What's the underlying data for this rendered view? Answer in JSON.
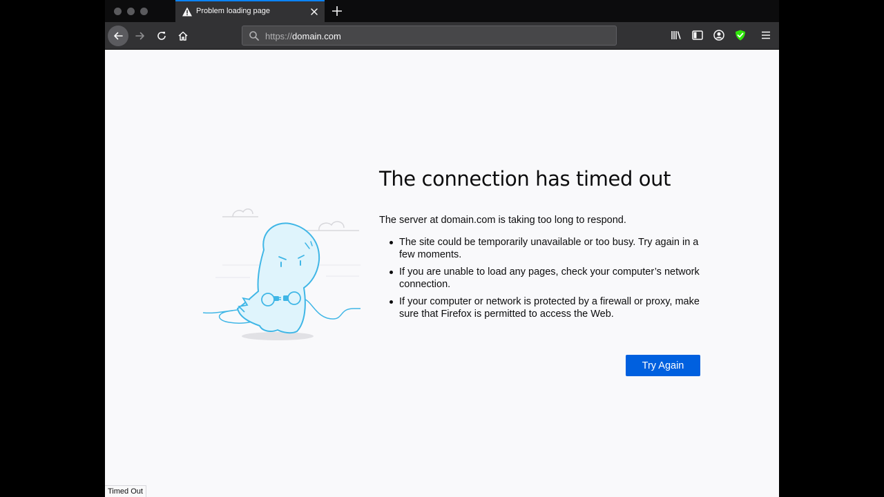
{
  "tab": {
    "title": "Problem loading page"
  },
  "urlbar": {
    "scheme": "https://",
    "host": "domain.com"
  },
  "error": {
    "title": "The connection has timed out",
    "description": "The server at domain.com is taking too long to respond.",
    "items": [
      "The site could be temporarily unavailable or too busy. Try again in a few moments.",
      "If you are unable to load any pages, check your computer’s network connection.",
      "If your computer or network is protected by a firewall or proxy, make sure that Firefox is permitted to access the Web."
    ],
    "button": "Try Again"
  },
  "status": {
    "text": "Timed Out"
  },
  "colors": {
    "accent": "#0a84ff",
    "button": "#0060df",
    "shield": "#30e60b",
    "illustration": "#3fb6e6"
  }
}
